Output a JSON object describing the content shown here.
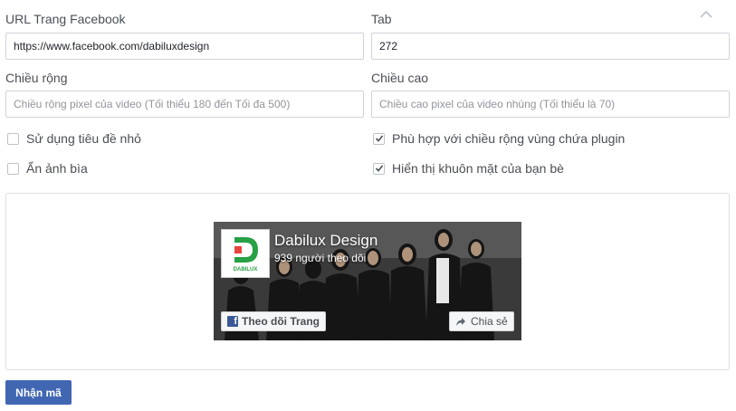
{
  "form": {
    "url_label": "URL Trang Facebook",
    "url_value": "https://www.facebook.com/dabiluxdesign",
    "tab_label": "Tab",
    "tab_value": "272",
    "width_label": "Chiều rộng",
    "width_placeholder": "Chiều rộng pixel của video (Tối thiểu 180 đến Tối đa 500)",
    "height_label": "Chiều cao",
    "height_placeholder": "Chiều cao pixel của video nhúng (Tối thiểu là 70)",
    "checkboxes": [
      {
        "label": "Sử dụng tiêu đề nhỏ",
        "checked": false
      },
      {
        "label": "Phù hợp với chiều rộng vùng chứa plugin",
        "checked": true
      },
      {
        "label": "Ẩn ảnh bìa",
        "checked": false
      },
      {
        "label": "Hiển thị khuôn mặt của bạn bè",
        "checked": true
      }
    ]
  },
  "preview": {
    "page_name": "Dabilux Design",
    "followers": "939 người theo dõi",
    "follow_label": "Theo dõi Trang",
    "share_label": "Chia sẻ",
    "logo_text": "DABILUX",
    "brand_color": "#27a046"
  },
  "actions": {
    "get_code_label": "Nhận mã"
  },
  "colors": {
    "facebook_blue": "#4267b2",
    "fb_square": "#3b5998"
  }
}
